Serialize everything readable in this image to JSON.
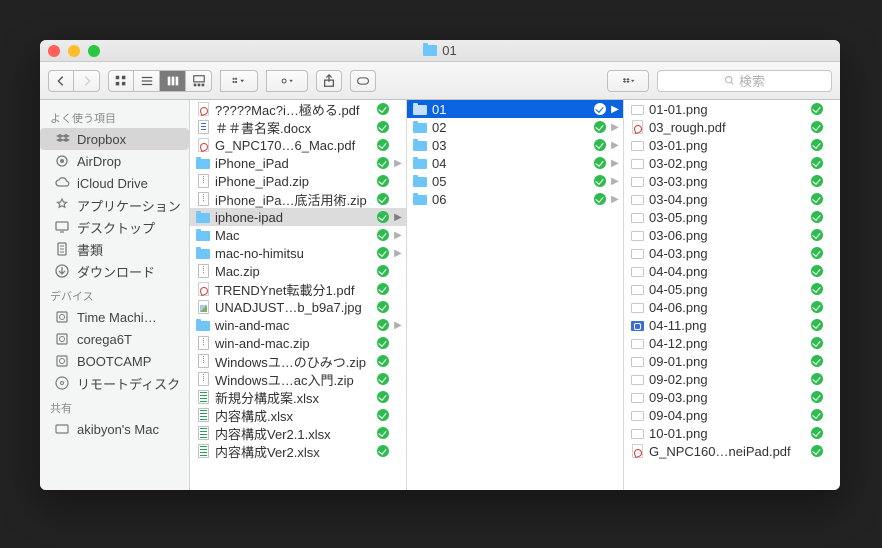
{
  "title": "01",
  "search_placeholder": "検索",
  "sidebar": {
    "sections": [
      {
        "header": "よく使う項目",
        "items": [
          {
            "label": "Dropbox",
            "icon": "dropbox",
            "sel": true
          },
          {
            "label": "AirDrop",
            "icon": "airdrop"
          },
          {
            "label": "iCloud Drive",
            "icon": "cloud"
          },
          {
            "label": "アプリケーション",
            "icon": "apps"
          },
          {
            "label": "デスクトップ",
            "icon": "desktop"
          },
          {
            "label": "書類",
            "icon": "docs"
          },
          {
            "label": "ダウンロード",
            "icon": "downloads"
          }
        ]
      },
      {
        "header": "デバイス",
        "items": [
          {
            "label": "Time Machi…",
            "icon": "disk"
          },
          {
            "label": "corega6T",
            "icon": "disk"
          },
          {
            "label": "BOOTCAMP",
            "icon": "disk"
          },
          {
            "label": "リモートディスク",
            "icon": "cd"
          }
        ]
      },
      {
        "header": "共有",
        "items": [
          {
            "label": "akibyon's Mac",
            "icon": "screen"
          }
        ]
      }
    ]
  },
  "columns": [
    [
      {
        "name": "?????Mac?i…極める.pdf",
        "type": "pdf",
        "sync": true
      },
      {
        "name": "＃＃書名案.docx",
        "type": "doc",
        "sync": true
      },
      {
        "name": "G_NPC170…6_Mac.pdf",
        "type": "pdf",
        "sync": true
      },
      {
        "name": "iPhone_iPad",
        "type": "folder",
        "sync": true,
        "arrow": true
      },
      {
        "name": "iPhone_iPad.zip",
        "type": "zip",
        "sync": true
      },
      {
        "name": "iPhone_iPa…底活用術.zip",
        "type": "zip",
        "sync": true
      },
      {
        "name": "iphone-ipad",
        "type": "folder",
        "sync": true,
        "arrow": true,
        "sel": "gray"
      },
      {
        "name": "Mac",
        "type": "folder",
        "sync": true,
        "arrow": true
      },
      {
        "name": "mac-no-himitsu",
        "type": "folder",
        "sync": true,
        "arrow": true
      },
      {
        "name": "Mac.zip",
        "type": "zip",
        "sync": true
      },
      {
        "name": "TRENDYnet転載分1.pdf",
        "type": "pdf",
        "sync": true
      },
      {
        "name": "UNADJUST…b_b9a7.jpg",
        "type": "img",
        "sync": true
      },
      {
        "name": "win-and-mac",
        "type": "folder",
        "sync": true,
        "arrow": true
      },
      {
        "name": "win-and-mac.zip",
        "type": "zip",
        "sync": true
      },
      {
        "name": "Windowsユ…のひみつ.zip",
        "type": "zip",
        "sync": true
      },
      {
        "name": "Windowsユ…ac入門.zip",
        "type": "zip",
        "sync": true
      },
      {
        "name": "新規分構成案.xlsx",
        "type": "xls",
        "sync": true
      },
      {
        "name": "内容構成.xlsx",
        "type": "xls",
        "sync": true
      },
      {
        "name": "内容構成Ver2.1.xlsx",
        "type": "xls",
        "sync": true
      },
      {
        "name": "内容構成Ver2.xlsx",
        "type": "xls",
        "sync": true
      }
    ],
    [
      {
        "name": "01",
        "type": "folder",
        "sync": true,
        "arrow": true,
        "sel": "blue"
      },
      {
        "name": "02",
        "type": "folder",
        "sync": true,
        "arrow": true
      },
      {
        "name": "03",
        "type": "folder",
        "sync": true,
        "arrow": true
      },
      {
        "name": "04",
        "type": "folder",
        "sync": true,
        "arrow": true
      },
      {
        "name": "05",
        "type": "folder",
        "sync": true,
        "arrow": true
      },
      {
        "name": "06",
        "type": "folder",
        "sync": true,
        "arrow": true
      }
    ],
    [
      {
        "name": "01-01.png",
        "type": "png",
        "sync": true
      },
      {
        "name": "03_rough.pdf",
        "type": "pdf",
        "sync": true
      },
      {
        "name": "03-01.png",
        "type": "png",
        "sync": true
      },
      {
        "name": "03-02.png",
        "type": "png",
        "sync": true
      },
      {
        "name": "03-03.png",
        "type": "png",
        "sync": true
      },
      {
        "name": "03-04.png",
        "type": "png",
        "sync": true
      },
      {
        "name": "03-05.png",
        "type": "png",
        "sync": true
      },
      {
        "name": "03-06.png",
        "type": "png",
        "sync": true
      },
      {
        "name": "04-03.png",
        "type": "png",
        "sync": true
      },
      {
        "name": "04-04.png",
        "type": "png",
        "sync": true
      },
      {
        "name": "04-05.png",
        "type": "png",
        "sync": true
      },
      {
        "name": "04-06.png",
        "type": "png",
        "sync": true
      },
      {
        "name": "04-11.png",
        "type": "png2",
        "sync": true
      },
      {
        "name": "04-12.png",
        "type": "png",
        "sync": true
      },
      {
        "name": "09-01.png",
        "type": "png",
        "sync": true
      },
      {
        "name": "09-02.png",
        "type": "png",
        "sync": true
      },
      {
        "name": "09-03.png",
        "type": "png",
        "sync": true
      },
      {
        "name": "09-04.png",
        "type": "png",
        "sync": true
      },
      {
        "name": "10-01.png",
        "type": "png",
        "sync": true
      },
      {
        "name": "G_NPC160…neiPad.pdf",
        "type": "pdf",
        "sync": true
      }
    ]
  ]
}
